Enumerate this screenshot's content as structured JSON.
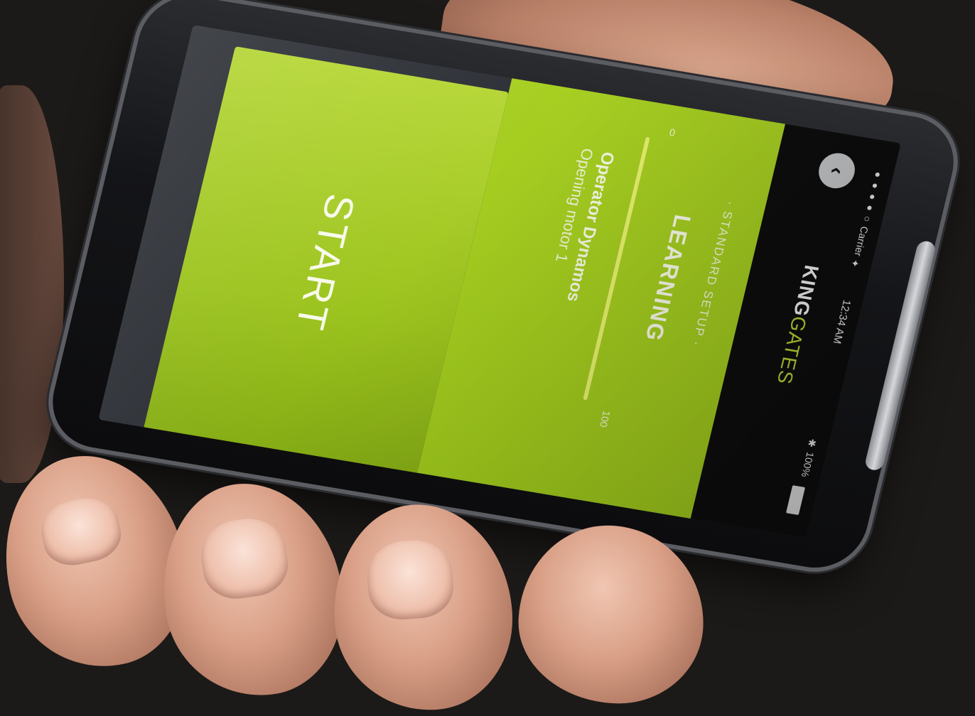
{
  "brand": {
    "king": "KING",
    "gates": "GATES"
  },
  "status": {
    "carrier": "●●●●○ Carrier ✦",
    "time": "12:34 AM",
    "battery": "✱ 100%"
  },
  "nav": {
    "back_glyph": "‹"
  },
  "setup": {
    "label": "· STANDARD SETUP ·",
    "title": "LEARNING",
    "operator_name": "Operator Dynamos",
    "operator_sub": "Opening motor 1"
  },
  "progress": {
    "min": "0",
    "max": "100",
    "value_fraction": 1.0
  },
  "start": {
    "label": "START"
  },
  "colors": {
    "accent": "#a5cd20",
    "header": "#0d0d0d"
  }
}
